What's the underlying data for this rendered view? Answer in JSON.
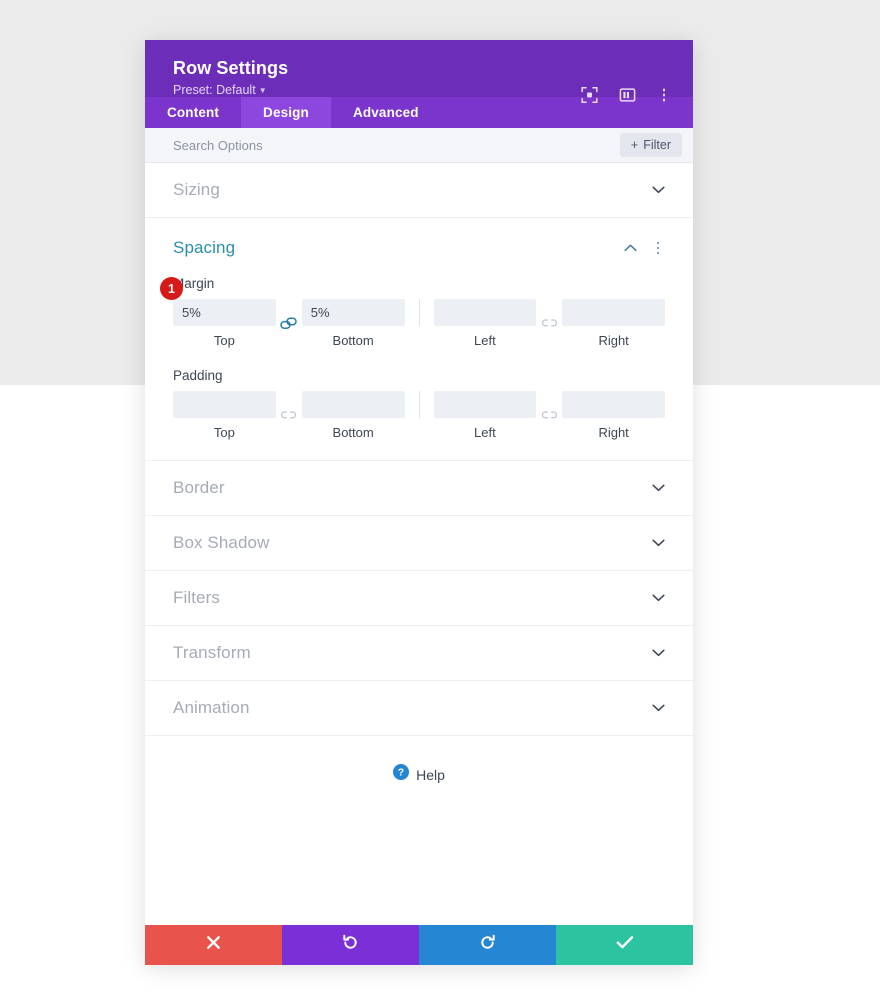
{
  "window": {
    "title": "Row Settings",
    "preset_label": "Preset: Default",
    "header_icons": [
      {
        "name": "fullscreen-preview-icon"
      },
      {
        "name": "layout-panel-icon"
      },
      {
        "name": "more-options-icon"
      }
    ]
  },
  "tabs": [
    {
      "label": "Content",
      "active": false
    },
    {
      "label": "Design",
      "active": true
    },
    {
      "label": "Advanced",
      "active": false
    }
  ],
  "search": {
    "value": "",
    "placeholder": "Search Options",
    "filter_label": "Filter",
    "filter_plus": "+"
  },
  "sections": [
    {
      "label": "Sizing",
      "state": "collapsed"
    },
    {
      "label": "Spacing",
      "state": "expanded"
    },
    {
      "label": "Border",
      "state": "collapsed"
    },
    {
      "label": "Box Shadow",
      "state": "collapsed"
    },
    {
      "label": "Filters",
      "state": "collapsed"
    },
    {
      "label": "Transform",
      "state": "collapsed"
    },
    {
      "label": "Animation",
      "state": "collapsed"
    }
  ],
  "spacing": {
    "title": "Spacing",
    "badge": "1",
    "margin": {
      "label": "Margin",
      "top": {
        "value": "5%",
        "placeholder": "",
        "caption": "Top"
      },
      "bottom": {
        "value": "5%",
        "placeholder": "",
        "caption": "Bottom"
      },
      "left": {
        "value": "",
        "placeholder": "",
        "caption": "Left"
      },
      "right": {
        "value": "",
        "placeholder": "",
        "caption": "Right"
      },
      "link_tb": "linked",
      "link_lr": "unlinked"
    },
    "padding": {
      "label": "Padding",
      "top": {
        "value": "",
        "placeholder": "",
        "caption": "Top"
      },
      "bottom": {
        "value": "",
        "placeholder": "",
        "caption": "Bottom"
      },
      "left": {
        "value": "",
        "placeholder": "",
        "caption": "Left"
      },
      "right": {
        "value": "",
        "placeholder": "",
        "caption": "Right"
      },
      "link_tb": "unlinked",
      "link_lr": "unlinked"
    }
  },
  "help": {
    "label": "Help",
    "icon": "question-mark-circle-icon"
  },
  "footer_buttons": [
    {
      "name": "discard-button",
      "icon": "close-x-icon",
      "color": "#e8544c"
    },
    {
      "name": "undo-button",
      "icon": "undo-arrow-icon",
      "color": "#7b2fd6"
    },
    {
      "name": "redo-button",
      "icon": "redo-arrow-icon",
      "color": "#2586d4"
    },
    {
      "name": "save-button",
      "icon": "checkmark-icon",
      "color": "#2cc4a0"
    }
  ],
  "colors": {
    "header_purple": "#6c2eb9",
    "tabbar_purple": "#7b34cc",
    "tab_active_purple": "#8e47de",
    "section_open_teal": "#2a8fae",
    "badge_red": "#d51a18",
    "page_bg": "#ebebeb"
  }
}
